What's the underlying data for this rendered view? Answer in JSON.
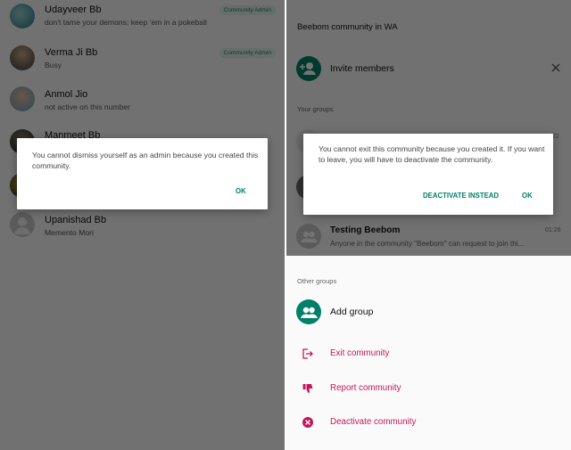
{
  "left": {
    "members": [
      {
        "name": "Udayveer Bb",
        "status": "don't tame your demons; keep 'em in a pokeball",
        "badge": "Community Admin"
      },
      {
        "name": "Verma Ji Bb",
        "status": "Busy",
        "badge": "Community Admin"
      },
      {
        "name": "Anmol Jio",
        "status": "not active on this number"
      },
      {
        "name": "Manmeet Bb",
        "status": ""
      },
      {
        "name": "",
        "status": ""
      },
      {
        "name": "Upanishad Bb",
        "status": "Memento Mori"
      }
    ],
    "dialog": {
      "message": "You cannot dismiss yourself as an admin because you created this community.",
      "ok_label": "OK"
    }
  },
  "right": {
    "community_title": "Beebom community in WA",
    "invite_label": "Invite members",
    "your_groups_label": "Your groups",
    "groups": [
      {
        "name": "Testing Beebom",
        "preview": "Anyone in the community \"Beebom\" can request to join thi...",
        "time": "01:26"
      }
    ],
    "partial_time": "22",
    "other_groups_label": "Other groups",
    "add_group_label": "Add group",
    "actions": [
      {
        "label": "Exit community",
        "icon": "exit-icon"
      },
      {
        "label": "Report community",
        "icon": "thumbs-down-icon"
      },
      {
        "label": "Deactivate community",
        "icon": "x-circle-icon"
      }
    ],
    "dialog": {
      "message": "You cannot exit this community because you created it. If you want to leave, you will have to deactivate the community.",
      "deactivate_label": "DEACTIVATE INSTEAD",
      "ok_label": "OK"
    }
  },
  "colors": {
    "accent": "#008069",
    "danger": "#c2185b",
    "badge_bg": "#dff4e8"
  }
}
